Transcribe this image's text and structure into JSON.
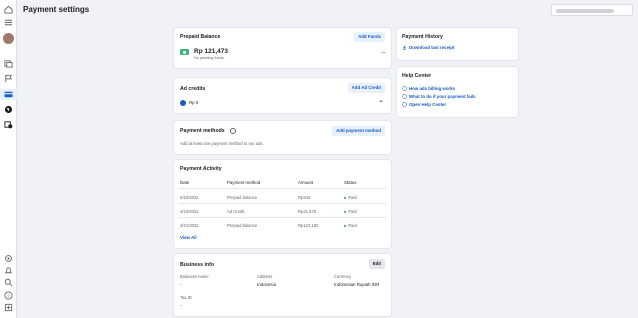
{
  "page": {
    "title": "Payment settings"
  },
  "search": {
    "placeholder": ""
  },
  "prepaid": {
    "title": "Prepaid Balance",
    "add_label": "Add Funds",
    "amount": "Rp 121,473",
    "sub": "No pending funds.",
    "more": "..."
  },
  "credits": {
    "title": "Ad credits",
    "add_label": "Add Ad Credit",
    "amount": "Rp 0",
    "chevron": "⌄"
  },
  "methods": {
    "title": "Payment methods",
    "add_label": "Add payment method",
    "sub": "Add at least one payment method to run ads."
  },
  "activity": {
    "title": "Payment Activity",
    "columns": [
      "Date",
      "Payment method",
      "Amount",
      "Status"
    ],
    "rows": [
      {
        "date": "5/22/2022",
        "method": "Prepaid balance",
        "amount": "Rp344",
        "status": "Paid"
      },
      {
        "date": "4/22/2022",
        "method": "Ad Credit",
        "amount": "Rp41,578",
        "status": "Paid"
      },
      {
        "date": "4/21/2022",
        "method": "Prepaid balance",
        "amount": "Rp123,180",
        "status": "Paid"
      }
    ],
    "view_all": "View All"
  },
  "business": {
    "title": "Business info",
    "edit_label": "Edit",
    "name_label": "Business name",
    "name_value": "-",
    "address_label": "Address",
    "address_value": "Indonesia",
    "currency_label": "Currency",
    "currency_value": "Indonesian Rupiah IDR",
    "tax_label": "Tax ID",
    "tax_value": "-"
  },
  "history": {
    "title": "Payment History",
    "link": "Download last receipt"
  },
  "help": {
    "title": "Help Center",
    "links": [
      "How ads billing works",
      "What to do if your payment fails",
      "Open Help Center"
    ]
  },
  "colors": {
    "accent": "#1b5bc6",
    "accent_bg": "#e7f0fd",
    "paid": "#31a24c",
    "bg": "#f0f2f5"
  }
}
